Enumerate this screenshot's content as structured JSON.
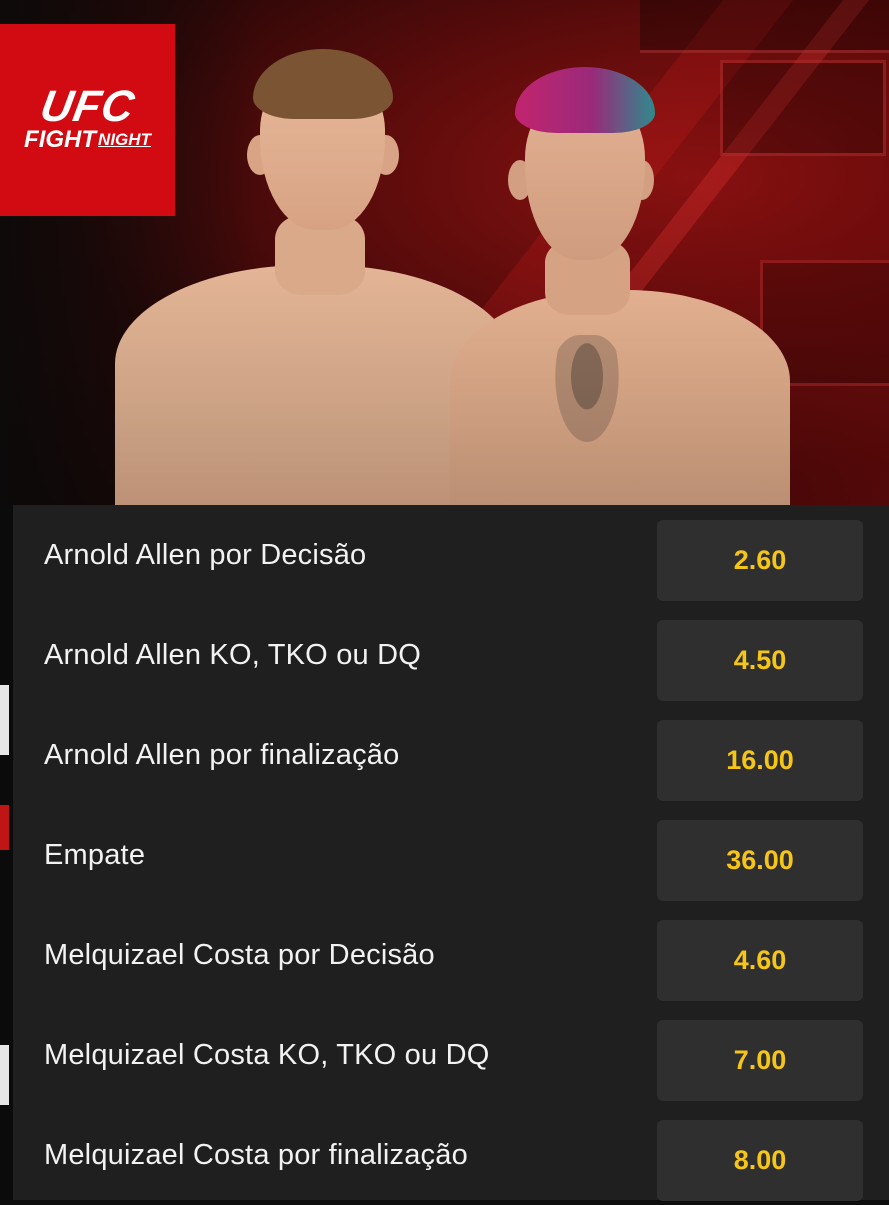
{
  "banner": {
    "logo_main": "UFC",
    "logo_fight": "FIGHT",
    "logo_night": "NIGHT",
    "accent_color": "#d20a11"
  },
  "market": {
    "odds_color": "#f5c518",
    "rows": [
      {
        "label": "Arnold Allen por Decisão",
        "odd": "2.60"
      },
      {
        "label": "Arnold Allen KO, TKO ou DQ",
        "odd": "4.50"
      },
      {
        "label": "Arnold Allen por finalização",
        "odd": "16.00"
      },
      {
        "label": "Empate",
        "odd": "36.00"
      },
      {
        "label": "Melquizael Costa por Decisão",
        "odd": "4.60"
      },
      {
        "label": "Melquizael Costa KO, TKO ou DQ",
        "odd": "7.00"
      },
      {
        "label": "Melquizael Costa por finalização",
        "odd": "8.00"
      }
    ]
  }
}
